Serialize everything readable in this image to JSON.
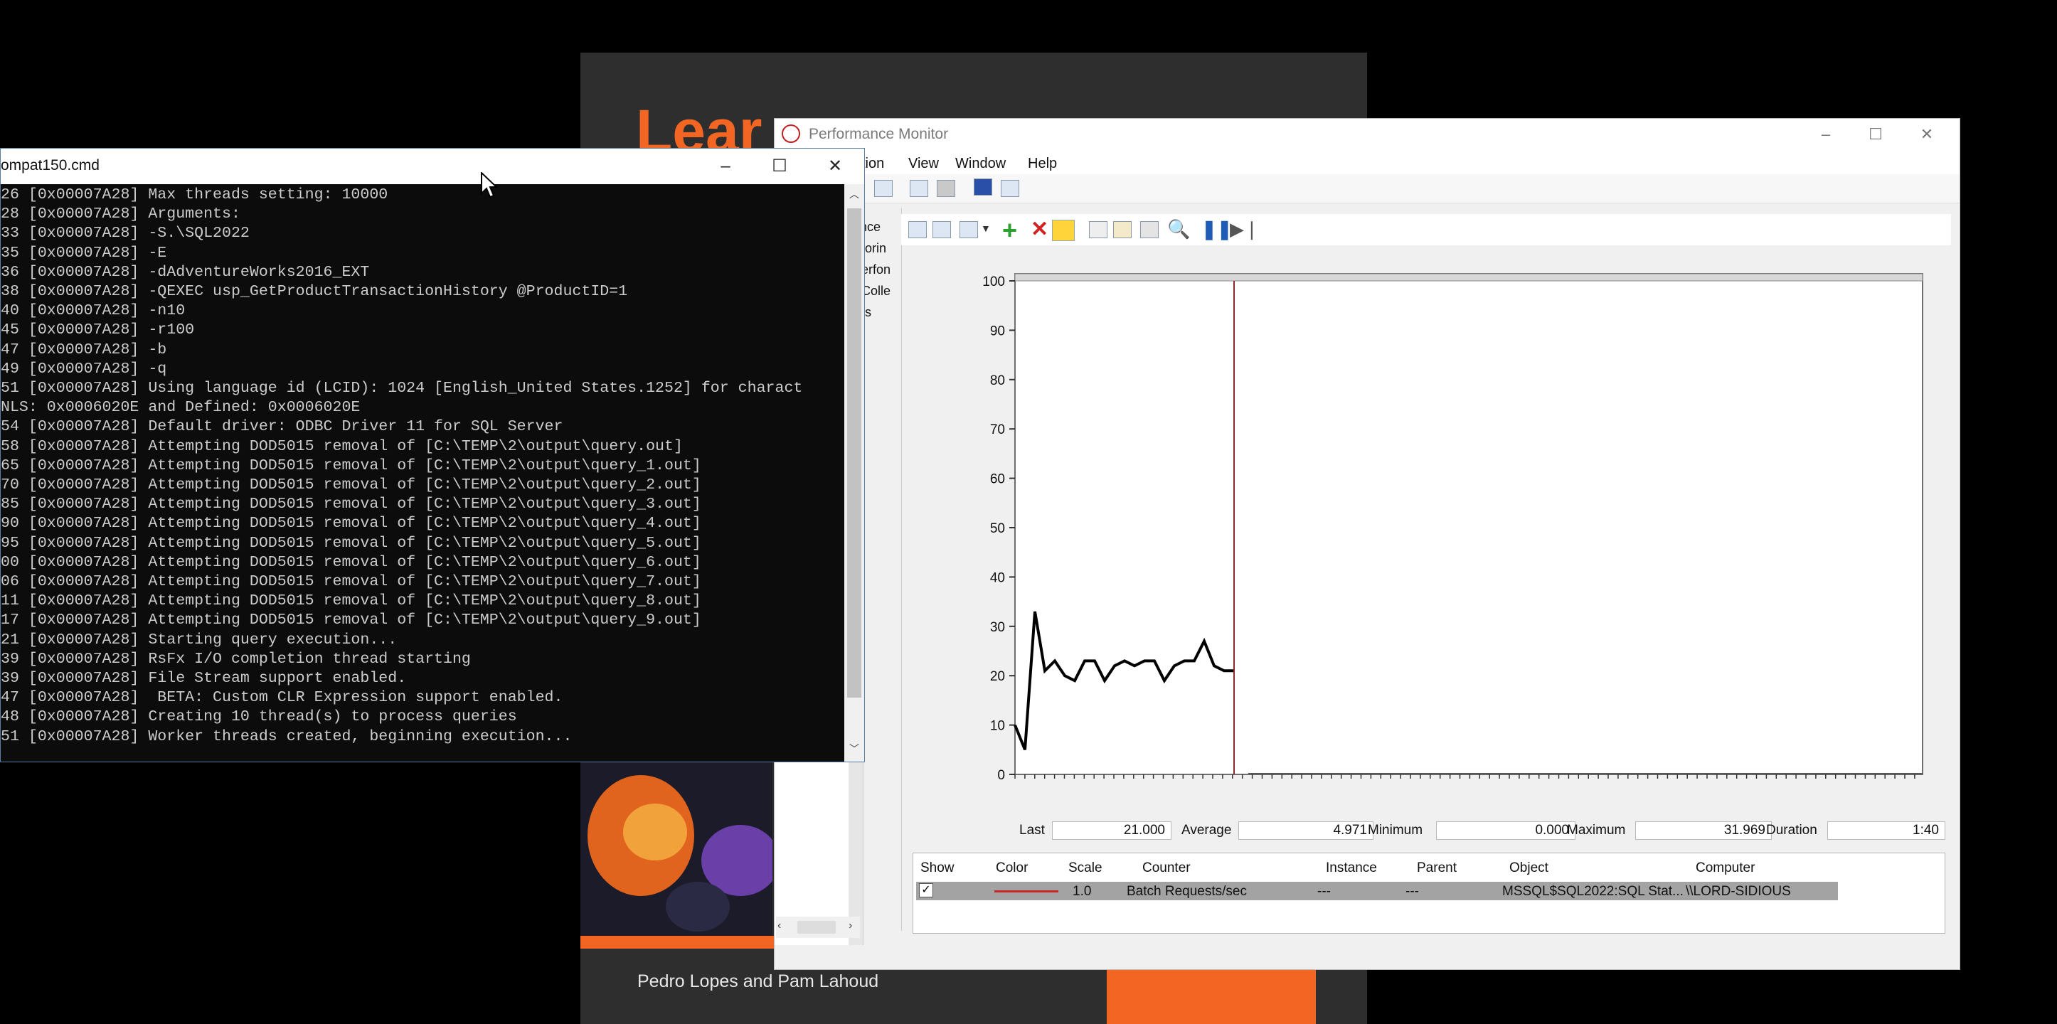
{
  "book": {
    "title_visible": "Lear",
    "authors": "Pedro Lopes and Pam Lahoud"
  },
  "perfmon": {
    "title": "Performance Monitor",
    "menu": [
      "tion",
      "View",
      "Window",
      "Help"
    ],
    "tree_items": [
      "nce",
      "torin",
      "erfon",
      "Colle",
      "ts"
    ],
    "graph": {
      "y_ticks": [
        "100",
        "90",
        "80",
        "70",
        "60",
        "50",
        "40",
        "30",
        "20",
        "10",
        "0"
      ],
      "ylim": [
        0,
        100
      ],
      "line_color": "#000000",
      "cursor_color": "#8b2b2b",
      "values": [
        10,
        5,
        33,
        21,
        23,
        20,
        19,
        23,
        23,
        19,
        22,
        23,
        22,
        23,
        23,
        19,
        22,
        23,
        23,
        27,
        22,
        21,
        21
      ]
    },
    "stats": {
      "last_label": "Last",
      "last_value": "21.000",
      "average_label": "Average",
      "average_value": "4.971",
      "minimum_label": "Minimum",
      "minimum_value": "0.000",
      "maximum_label": "Maximum",
      "maximum_value": "31.969",
      "duration_label": "Duration",
      "duration_value": "1:40"
    },
    "counters": {
      "headers": {
        "show": "Show",
        "color": "Color",
        "scale": "Scale",
        "counter": "Counter",
        "instance": "Instance",
        "parent": "Parent",
        "object": "Object",
        "computer": "Computer"
      },
      "row": {
        "checked": "✓",
        "color": "#c62828",
        "scale": "1.0",
        "counter": "Batch Requests/sec",
        "instance": "---",
        "parent": "---",
        "object": "MSSQL$SQL2022:SQL Stat...",
        "computer": "\\\\LORD-SIDIOUS"
      }
    }
  },
  "cmd": {
    "title": "ompat150.cmd",
    "lines": [
      "26 [0x00007A28] Max threads setting: 10000",
      "28 [0x00007A28] Arguments:",
      "33 [0x00007A28] -S.\\SQL2022",
      "35 [0x00007A28] -E",
      "36 [0x00007A28] -dAdventureWorks2016_EXT",
      "38 [0x00007A28] -QEXEC usp_GetProductTransactionHistory @ProductID=1",
      "40 [0x00007A28] -n10",
      "45 [0x00007A28] -r100",
      "47 [0x00007A28] -b",
      "49 [0x00007A28] -q",
      "51 [0x00007A28] Using language id (LCID): 1024 [English_United States.1252] for charact",
      "NLS: 0x0006020E and Defined: 0x0006020E",
      "54 [0x00007A28] Default driver: ODBC Driver 11 for SQL Server",
      "58 [0x00007A28] Attempting DOD5015 removal of [C:\\TEMP\\2\\output\\query.out]",
      "65 [0x00007A28] Attempting DOD5015 removal of [C:\\TEMP\\2\\output\\query_1.out]",
      "70 [0x00007A28] Attempting DOD5015 removal of [C:\\TEMP\\2\\output\\query_2.out]",
      "85 [0x00007A28] Attempting DOD5015 removal of [C:\\TEMP\\2\\output\\query_3.out]",
      "90 [0x00007A28] Attempting DOD5015 removal of [C:\\TEMP\\2\\output\\query_4.out]",
      "95 [0x00007A28] Attempting DOD5015 removal of [C:\\TEMP\\2\\output\\query_5.out]",
      "00 [0x00007A28] Attempting DOD5015 removal of [C:\\TEMP\\2\\output\\query_6.out]",
      "06 [0x00007A28] Attempting DOD5015 removal of [C:\\TEMP\\2\\output\\query_7.out]",
      "11 [0x00007A28] Attempting DOD5015 removal of [C:\\TEMP\\2\\output\\query_8.out]",
      "17 [0x00007A28] Attempting DOD5015 removal of [C:\\TEMP\\2\\output\\query_9.out]",
      "21 [0x00007A28] Starting query execution...",
      "39 [0x00007A28] RsFx I/O completion thread starting",
      "39 [0x00007A28] File Stream support enabled.",
      "47 [0x00007A28]  BETA: Custom CLR Expression support enabled.",
      "48 [0x00007A28] Creating 10 thread(s) to process queries",
      "51 [0x00007A28] Worker threads created, beginning execution..."
    ]
  }
}
